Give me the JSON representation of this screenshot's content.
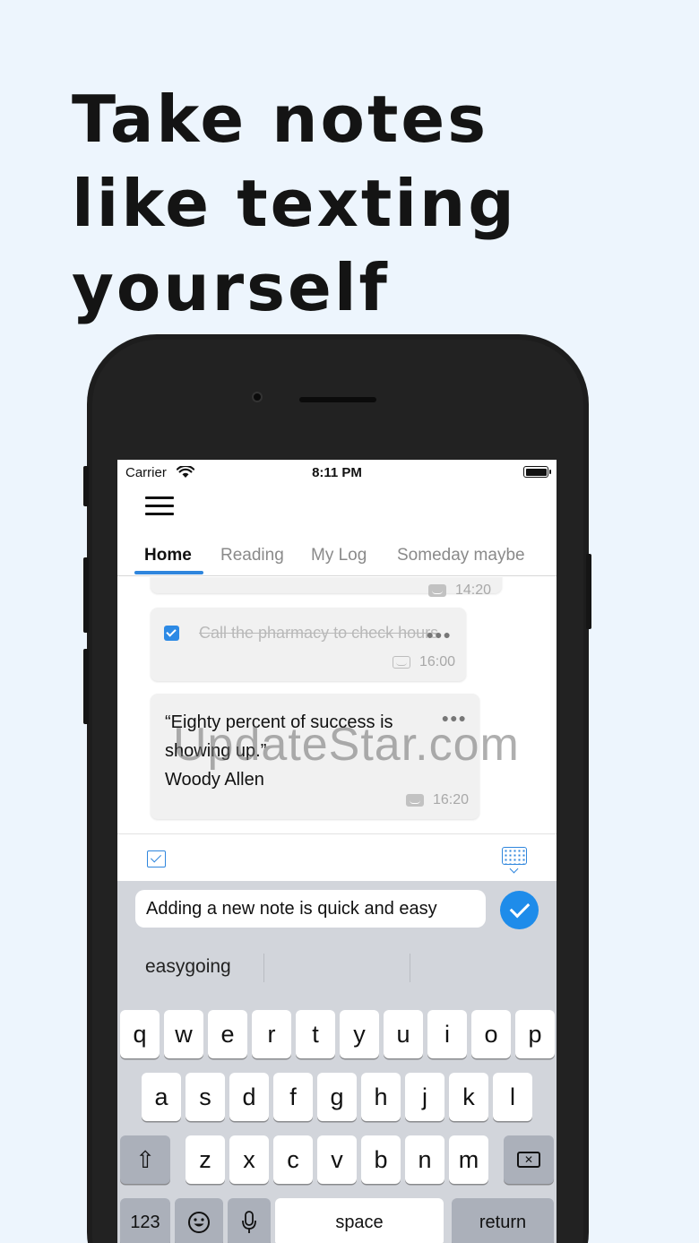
{
  "headline": "Take notes like texting yourself",
  "status_bar": {
    "carrier": "Carrier",
    "time": "8:11 PM"
  },
  "tabs": [
    {
      "label": "Home",
      "active": true
    },
    {
      "label": "Reading",
      "active": false
    },
    {
      "label": "My Log",
      "active": false
    },
    {
      "label": "Someday maybe",
      "active": false
    }
  ],
  "notes": [
    {
      "text": "",
      "time": "14:20",
      "partial": true
    },
    {
      "text": "Call the pharmacy to check hours",
      "time": "16:00",
      "done": true
    },
    {
      "text": "“Eighty percent of success is showing up.”\nWoody Allen",
      "time": "16:20",
      "done": false
    }
  ],
  "watermark": "UpdateStar.com",
  "compose": {
    "value": "Adding a new note is quick and easy",
    "placeholder": ""
  },
  "suggestions": [
    "easygoing",
    "",
    ""
  ],
  "keyboard": {
    "row1": [
      "q",
      "w",
      "e",
      "r",
      "t",
      "y",
      "u",
      "i",
      "o",
      "p"
    ],
    "row2": [
      "a",
      "s",
      "d",
      "f",
      "g",
      "h",
      "j",
      "k",
      "l"
    ],
    "row3": [
      "z",
      "x",
      "c",
      "v",
      "b",
      "n",
      "m"
    ],
    "numbers_label": "123",
    "space_label": "space",
    "return_label": "return"
  },
  "colors": {
    "accent": "#2f86dd",
    "send": "#1e8cea",
    "background": "#edf5fd",
    "keyboard_bg": "#d2d5db"
  }
}
